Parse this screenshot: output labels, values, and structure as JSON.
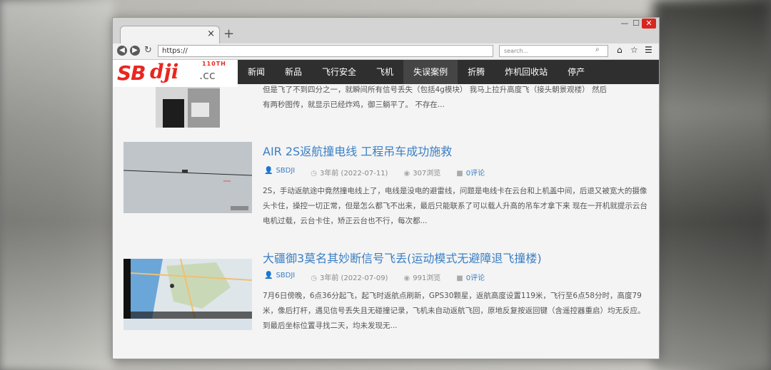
{
  "browser": {
    "url": "https://",
    "search_placeholder": "search...",
    "tab_close": "×",
    "new_tab": "+",
    "window_controls": {
      "minimize": "—",
      "maximize": "☐",
      "close": "✕"
    },
    "icons": {
      "back": "arrow-left-icon",
      "forward": "arrow-right-icon",
      "reload": "reload-icon",
      "home": "home-icon",
      "star": "star-icon",
      "menu": "hamburger-icon",
      "search": "search-icon"
    }
  },
  "site": {
    "logo": {
      "sb": "SB",
      "dji": "dji",
      "cc": ".cc",
      "tag": "110TH"
    },
    "nav": [
      "新闻",
      "新品",
      "飞行安全",
      "飞机",
      "失误案例",
      "折腾",
      "炸机回收站",
      "停产"
    ],
    "active_nav": "失误案例",
    "accent_color": "#3a7fc4",
    "logo_color": "#e8271f"
  },
  "articles": [
    {
      "excerpt_line1": "但是飞了不到四分之一，就瞬间所有信号丢失（包括4g模块） 我马上拉升高度飞（接头朝景观楼） 然后",
      "excerpt_line2": "有两秒图传，就显示已经炸鸡，御三躺平了。 不存在..."
    },
    {
      "title": "AIR 2S返航撞电线 工程吊车成功施救",
      "author": "SBDJI",
      "date": "3年前 (2022-07-11)",
      "views": "307浏览",
      "comments": "0评论",
      "excerpt": "2S，手动返航途中竟然撞电线上了，电线是没电的避雷线，问题是电线卡在云台和上机盖中间，后退又被宽大的摄像头卡住，操控一切正常，但是怎么都飞不出来，最后只能联系了可以载人升高的吊车才拿下来 现在一开机就提示云台电机过载，云台卡住，矫正云台也不行，每次都..."
    },
    {
      "title": "大疆御3莫名其妙断信号飞丢(运动模式无避障退飞撞楼)",
      "author": "SBDJI",
      "date": "3年前 (2022-07-09)",
      "views": "991浏览",
      "comments": "0评论",
      "excerpt": "7月6日傍晚，6点36分起飞，起飞时返航点刷新，GPS30颗星，返航高度设置119米，飞行至6点58分时，高度79米，像后打杆，遇见信号丢失且无碰撞记录，飞机未自动返航飞回，原地反复按返回键（含遥控器重启）均无反应。到最后坐标位置寻找二天，均未发现无..."
    }
  ]
}
